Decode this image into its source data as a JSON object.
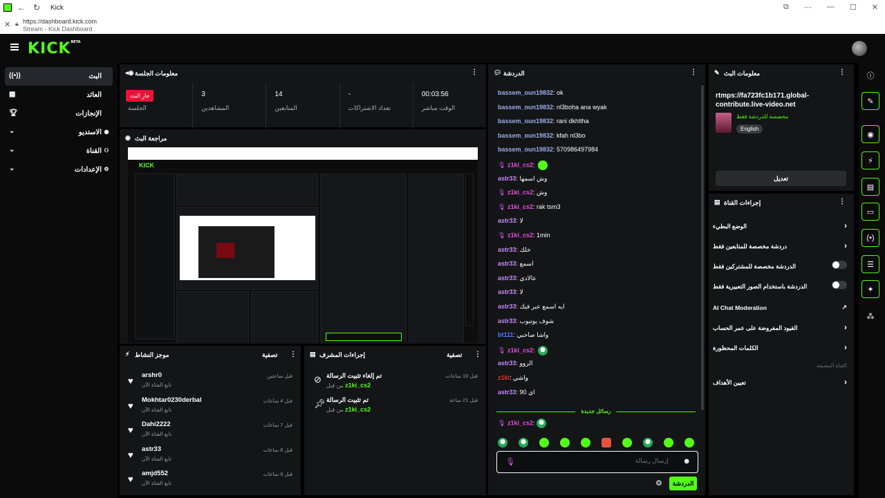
{
  "browser": {
    "tab_title": "Kick",
    "url": "https://dashboard.kick.com",
    "page_subtitle": "Stream - Kick Dashboard"
  },
  "app": {
    "logo": "KICK",
    "logo_badge": "BETA"
  },
  "nav": {
    "items": [
      {
        "label": "البث",
        "icon": "broadcast-icon"
      },
      {
        "label": "العائد",
        "icon": "revenue-icon"
      },
      {
        "label": "الإنجازات",
        "icon": "trophy-icon"
      },
      {
        "label": "الاستديو",
        "icon": "studio-icon"
      },
      {
        "label": "القناة",
        "icon": "channel-icon"
      },
      {
        "label": "الإعدادات",
        "icon": "gear-icon"
      }
    ]
  },
  "session": {
    "title": "معلومات الجلسة",
    "live_badge": "جارِ البث",
    "stats": [
      {
        "value": "",
        "label": "الجلسة"
      },
      {
        "value": "3",
        "label": "المشاهدين"
      },
      {
        "value": "14",
        "label": "المتابعين"
      },
      {
        "value": "-",
        "label": "تعداد الاشتراكات"
      },
      {
        "value": "00:03:56",
        "label": "الوقت مباشر"
      }
    ]
  },
  "preview": {
    "title": "مراجعة البث"
  },
  "activity": {
    "title": "موجز النشاط",
    "filter": "تصفية",
    "items": [
      {
        "name": "arshr0",
        "action": "تابع القناة الآن",
        "time": "قبل ساعتين"
      },
      {
        "name": "Mokhtar0230derbal",
        "action": "تابع القناة الآن",
        "time": "قبل 4 ساعات"
      },
      {
        "name": "Dahi2222",
        "action": "تابع القناة الآن",
        "time": "قبل 7 ساعات"
      },
      {
        "name": "astr33",
        "action": "تابع القناة الآن",
        "time": "قبل 8 ساعات"
      },
      {
        "name": "amjd552",
        "action": "تابع القناة الآن",
        "time": "قبل 9 ساعات"
      }
    ]
  },
  "mod": {
    "title": "إجراءات المشرف",
    "filter": "تصفية",
    "items": [
      {
        "title": "تم إلغاء تثبيت الرسالة",
        "by_label": "من قبل",
        "by": "z1ki_cs2",
        "time": "قبل 10 ساعات",
        "icon": "unpin-icon"
      },
      {
        "title": "تم تثبيت الرسالة",
        "by_label": "من قبل",
        "by": "z1ki_cs2",
        "time": "قبل 21 ساعة",
        "icon": "pin-icon"
      }
    ]
  },
  "chat": {
    "title": "الدردشة",
    "messages": [
      {
        "user": "bassem_oun19832",
        "text": ": ok",
        "color": "blue"
      },
      {
        "user": "bassem_oun19832",
        "text": ": nl3boha ana wyak",
        "color": "blue"
      },
      {
        "user": "bassem_oun19832",
        "text": ": rani dkhltha",
        "color": "blue"
      },
      {
        "user": "bassem_oun19832",
        "text": ": kfah nl3bo",
        "color": "blue"
      },
      {
        "user": "bassem_oun19832",
        "text": ": 570986497984",
        "color": "blue"
      },
      {
        "user": "z1ki_cs2",
        "text": ":",
        "color": "magenta",
        "mic": true,
        "emote": true
      },
      {
        "user": "astr33",
        "text": ": وش اسمها",
        "color": "purple"
      },
      {
        "user": "z1ki_cs2",
        "text": ": وش",
        "color": "magenta",
        "mic": true
      },
      {
        "user": "z1ki_cs2",
        "text": ": rak tsm3",
        "color": "magenta",
        "mic": true
      },
      {
        "user": "astr33",
        "text": ": لا",
        "color": "purple"
      },
      {
        "user": "z1ki_cs2",
        "text": ": 1min",
        "color": "magenta",
        "mic": true
      },
      {
        "user": "astr33",
        "text": ": خلك",
        "color": "purple"
      },
      {
        "user": "astr33",
        "text": ": اسمع",
        "color": "purple"
      },
      {
        "user": "astr33",
        "text": ": عالادي",
        "color": "purple"
      },
      {
        "user": "astr33",
        "text": ": لا",
        "color": "purple"
      },
      {
        "user": "astr33",
        "text": ": ايه اسمع عبر فيك",
        "color": "purple"
      },
      {
        "user": "astr33",
        "text": ": شوف يوتيوب",
        "color": "purple"
      },
      {
        "user": "bt111",
        "text": ": واشا صاحبي",
        "color": "blue2"
      },
      {
        "user": "z1ki_cs2",
        "text": ":",
        "color": "magenta",
        "mic": true,
        "emote": true,
        "emote_style": "grey"
      },
      {
        "user": "astr33",
        "text": ": الروو",
        "color": "purple"
      },
      {
        "user": "z1ki",
        "text": ": واشي",
        "color": "red"
      },
      {
        "user": "astr33",
        "text": ": اي 90",
        "color": "purple"
      }
    ],
    "new_messages": "رسائل جديدة",
    "last_message": {
      "user": "z1ki_cs2",
      "text": ":"
    },
    "input_placeholder": "إرسال رسالة",
    "send_label": "الدردشة"
  },
  "stream_info": {
    "title": "معلومات البث",
    "rtmp": "rtmps://fa723fc1b171.global-contribute.live-video.net",
    "category": "مخصصة للدردشة فقط",
    "language": "English",
    "edit_label": "تعديل"
  },
  "channel_actions": {
    "title": "إجراءات القناة",
    "rows": [
      {
        "label": "الوضع البطيء",
        "kind": "chevron"
      },
      {
        "label": "دردشة مخصصة للمتابعين فقط",
        "kind": "chevron"
      },
      {
        "label": "الدردشة مخصصة للمشتركين فقط",
        "kind": "toggle"
      },
      {
        "label": "الدردشة باستخدام الصور التعبيرية فقط",
        "kind": "toggle"
      },
      {
        "label": "AI Chat Moderation",
        "kind": "external"
      },
      {
        "label": "القيود المفروضة على عمر الحساب",
        "kind": "chevron"
      },
      {
        "label": "الكلمات المحظورة",
        "kind": "chevron"
      },
      {
        "label": "تعيين الأهداف",
        "kind": "chevron"
      }
    ],
    "section_label": "القناة المضيفة"
  },
  "colors": {
    "accent": "#53fc18",
    "live": "#e3163a",
    "panel": "#141517",
    "bg": "#000000"
  }
}
